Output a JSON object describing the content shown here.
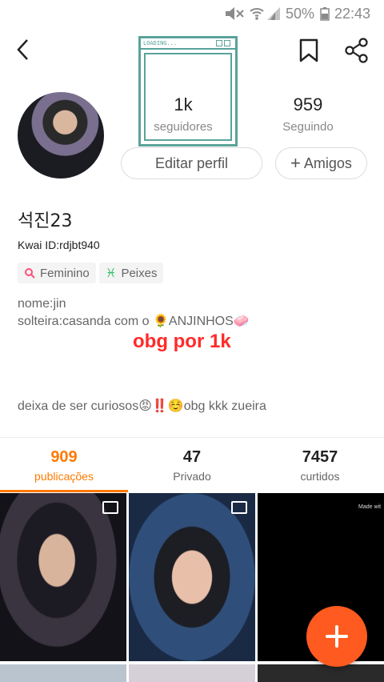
{
  "status_bar": {
    "battery_percent": "50%",
    "time": "22:43"
  },
  "frame": {
    "title": "LOADING..."
  },
  "stats": {
    "followers": {
      "count": "1k",
      "label": "seguidores"
    },
    "following": {
      "count": "959",
      "label": "Seguindo"
    }
  },
  "buttons": {
    "edit_profile": "Editar perfil",
    "friends": "Amigos"
  },
  "profile": {
    "name": "석진23",
    "kwai_id": "Kwai ID:rdjbt940",
    "tags": [
      {
        "label": "Feminino"
      },
      {
        "label": "Peixes"
      }
    ],
    "bio": {
      "line1": "nome:jin",
      "line2": "solteira:casanda com o 🌻ANJINHOS🧼",
      "highlight": "obg por 1k",
      "line3": "deixa de ser curiosos😡‼️☺️obg kkk zueira"
    }
  },
  "tabs": [
    {
      "count": "909",
      "label": "publicações",
      "active": true
    },
    {
      "count": "47",
      "label": "Privado",
      "active": false
    },
    {
      "count": "7457",
      "label": "curtidos",
      "active": false
    }
  ],
  "grid": {
    "watermark": "Made wit"
  },
  "colors": {
    "accent": "#ff7a00",
    "fab": "#ff5a1f",
    "highlight": "#ff2a2a",
    "frame": "#5aa39a"
  }
}
